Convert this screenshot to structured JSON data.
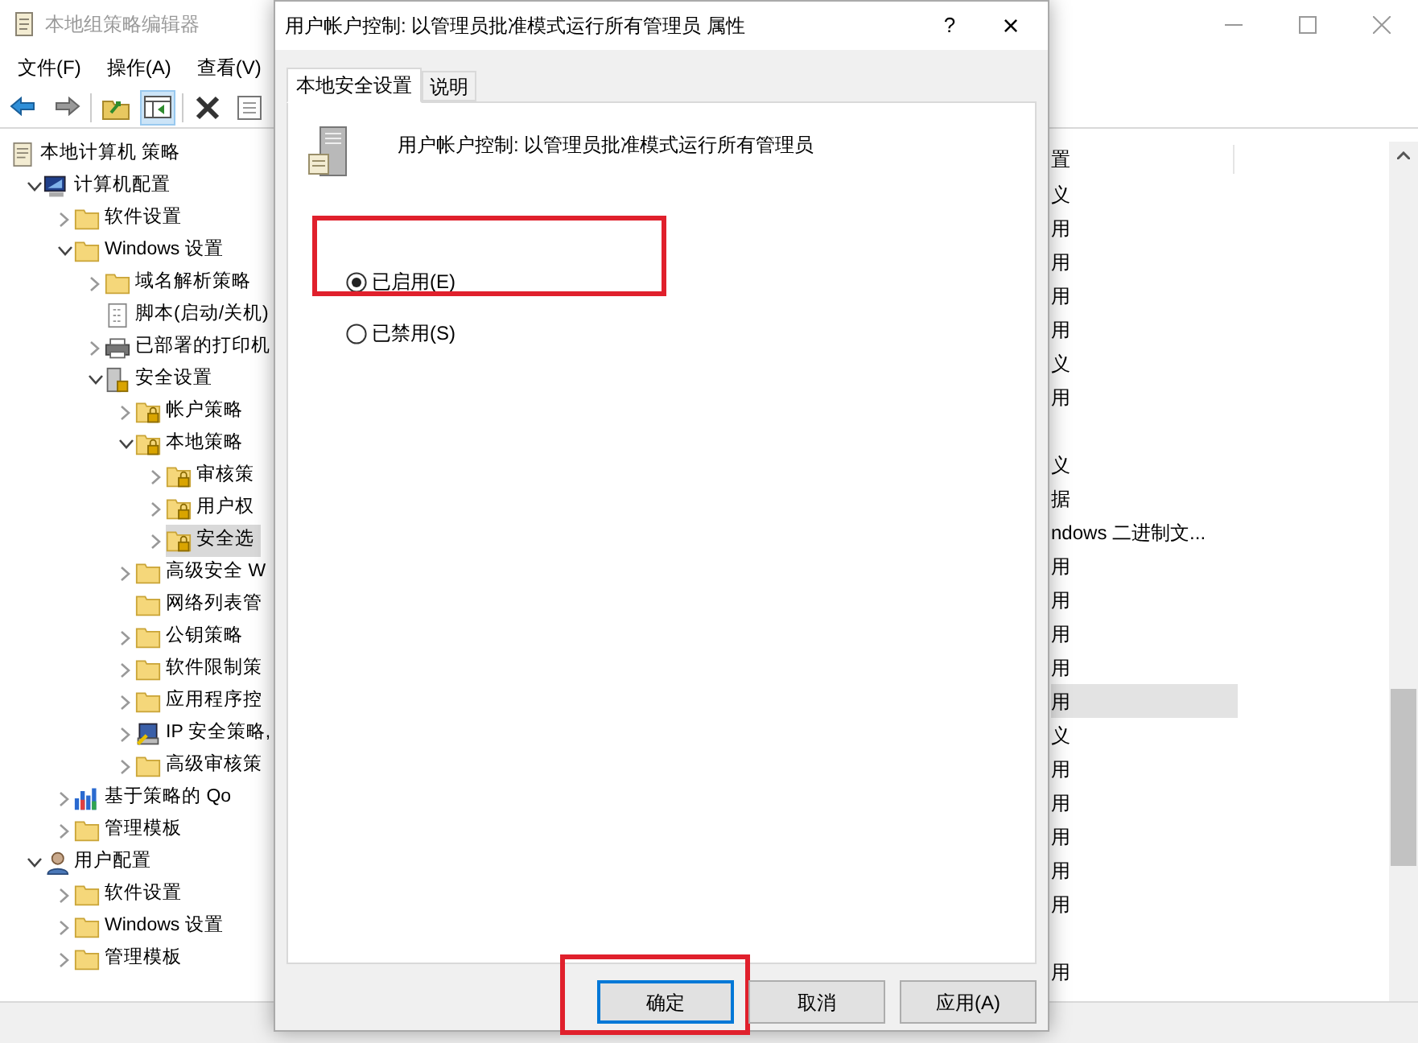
{
  "main_window": {
    "title": "本地组策略编辑器",
    "menu": [
      "文件(F)",
      "操作(A)",
      "查看(V)"
    ],
    "toolbar": [
      {
        "kind": "back",
        "selected": false
      },
      {
        "kind": "forward",
        "selected": false
      },
      {
        "kind": "up",
        "selected": false
      },
      {
        "kind": "pane",
        "selected": true
      },
      {
        "kind": "delete",
        "selected": false
      },
      {
        "kind": "properties",
        "selected": false
      }
    ],
    "tree": [
      {
        "label": "本地计算机 策略",
        "kind": "policy",
        "selected": false,
        "children": [
          {
            "label": "计算机配置",
            "kind": "computer",
            "expanded": true,
            "selected": false,
            "children": [
              {
                "label": "软件设置",
                "kind": "folder",
                "expanded": false,
                "selected": false
              },
              {
                "label": "Windows 设置",
                "kind": "folder",
                "expanded": true,
                "selected": false,
                "children": [
                  {
                    "label": "域名解析策略",
                    "kind": "folder",
                    "expanded": false,
                    "selected": false
                  },
                  {
                    "label": "脚本(启动/关机)",
                    "kind": "script",
                    "selected": false
                  },
                  {
                    "label": "已部署的打印机",
                    "kind": "printer",
                    "expanded": false,
                    "selected": false
                  },
                  {
                    "label": "安全设置",
                    "kind": "security",
                    "expanded": true,
                    "selected": false,
                    "children": [
                      {
                        "label": "帐户策略",
                        "kind": "lockfolder",
                        "expanded": false,
                        "selected": false
                      },
                      {
                        "label": "本地策略",
                        "kind": "lockfolder",
                        "expanded": true,
                        "selected": false,
                        "children": [
                          {
                            "label": "审核策",
                            "kind": "lockfolder",
                            "expanded": false,
                            "selected": false
                          },
                          {
                            "label": "用户权",
                            "kind": "lockfolder",
                            "expanded": false,
                            "selected": false
                          },
                          {
                            "label": "安全选",
                            "kind": "lockfolder",
                            "expanded": false,
                            "selected": true
                          }
                        ]
                      },
                      {
                        "label": "高级安全 W",
                        "kind": "folder",
                        "expanded": false,
                        "selected": false
                      },
                      {
                        "label": "网络列表管",
                        "kind": "folder",
                        "selected": false
                      },
                      {
                        "label": "公钥策略",
                        "kind": "folder",
                        "expanded": false,
                        "selected": false
                      },
                      {
                        "label": "软件限制策",
                        "kind": "folder",
                        "expanded": false,
                        "selected": false
                      },
                      {
                        "label": "应用程序控",
                        "kind": "folder",
                        "expanded": false,
                        "selected": false
                      },
                      {
                        "label": "IP 安全策略,",
                        "kind": "ip",
                        "expanded": false,
                        "selected": false
                      },
                      {
                        "label": "高级审核策",
                        "kind": "folder",
                        "expanded": false,
                        "selected": false
                      }
                    ]
                  }
                ]
              },
              {
                "label": "基于策略的 Qo",
                "kind": "chart",
                "expanded": false,
                "selected": false
              },
              {
                "label": "管理模板",
                "kind": "folder",
                "expanded": false,
                "selected": false
              }
            ]
          },
          {
            "label": "用户配置",
            "kind": "user",
            "expanded": true,
            "selected": false,
            "children": [
              {
                "label": "软件设置",
                "kind": "folder",
                "expanded": false,
                "selected": false
              },
              {
                "label": "Windows 设置",
                "kind": "folder",
                "expanded": false,
                "selected": false
              },
              {
                "label": "管理模板",
                "kind": "folder",
                "expanded": false,
                "selected": false
              }
            ]
          }
        ]
      }
    ],
    "list_header": "置",
    "list_rows": [
      {
        "text": "义",
        "selected": false
      },
      {
        "text": "用",
        "selected": false
      },
      {
        "text": "用",
        "selected": false
      },
      {
        "text": "用",
        "selected": false
      },
      {
        "text": "用",
        "selected": false
      },
      {
        "text": "义",
        "selected": false
      },
      {
        "text": "用",
        "selected": false
      },
      {
        "selected": false
      },
      {
        "text": "义",
        "selected": false
      },
      {
        "text": "据",
        "selected": false
      },
      {
        "text": "ndows 二进制文...",
        "selected": false
      },
      {
        "text": "用",
        "selected": false
      },
      {
        "text": "用",
        "selected": false
      },
      {
        "text": "用",
        "selected": false
      },
      {
        "text": "用",
        "selected": false
      },
      {
        "text": "用",
        "selected": true
      },
      {
        "text": "义",
        "selected": false
      },
      {
        "text": "用",
        "selected": false
      },
      {
        "text": "用",
        "selected": false
      },
      {
        "text": "用",
        "selected": false
      },
      {
        "text": "用",
        "selected": false
      },
      {
        "text": "用",
        "selected": false
      },
      {
        "selected": false
      },
      {
        "text": "用",
        "selected": false
      }
    ]
  },
  "dialog": {
    "title": "用户帐户控制: 以管理员批准模式运行所有管理员 属性",
    "help": "?",
    "close": "×",
    "tabs": [
      {
        "label": "本地安全设置",
        "selected": true
      },
      {
        "label": "说明",
        "selected": false
      }
    ],
    "policy_name": "用户帐户控制: 以管理员批准模式运行所有管理员",
    "options": [
      {
        "label": "已启用(E)",
        "selected": true,
        "highlighted": true
      },
      {
        "label": "已禁用(S)",
        "selected": false,
        "highlighted": false
      }
    ],
    "buttons": [
      {
        "label": "确定",
        "default": true,
        "highlighted": true
      },
      {
        "label": "取消",
        "default": false,
        "highlighted": false
      },
      {
        "label": "应用(A)",
        "default": false,
        "highlighted": false
      }
    ]
  }
}
